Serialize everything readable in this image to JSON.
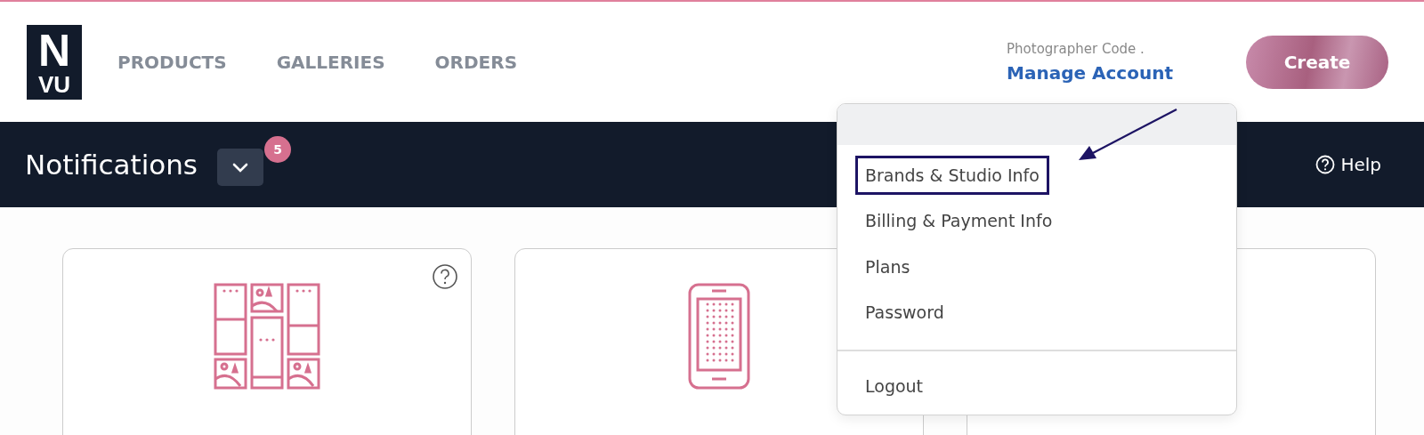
{
  "logo": {
    "top": "N",
    "bottom": "VU"
  },
  "nav": [
    "PRODUCTS",
    "GALLERIES",
    "ORDERS"
  ],
  "account": {
    "code_label": "Photographer Code .",
    "link": "Manage Account"
  },
  "create_button": "Create",
  "notifications": {
    "title": "Notifications",
    "badge": "5"
  },
  "help": "Help",
  "cards": [
    {
      "kind": "gallery",
      "help": true
    },
    {
      "kind": "phone"
    },
    {
      "kind": "blank",
      "help": false
    }
  ],
  "account_menu": {
    "items": [
      {
        "label": "Brands & Studio Info",
        "highlighted": true
      },
      {
        "label": "Billing & Payment Info",
        "highlighted": false
      },
      {
        "label": "Plans",
        "highlighted": false
      },
      {
        "label": "Password",
        "highlighted": false
      }
    ],
    "footer_items": [
      "Logout"
    ]
  }
}
